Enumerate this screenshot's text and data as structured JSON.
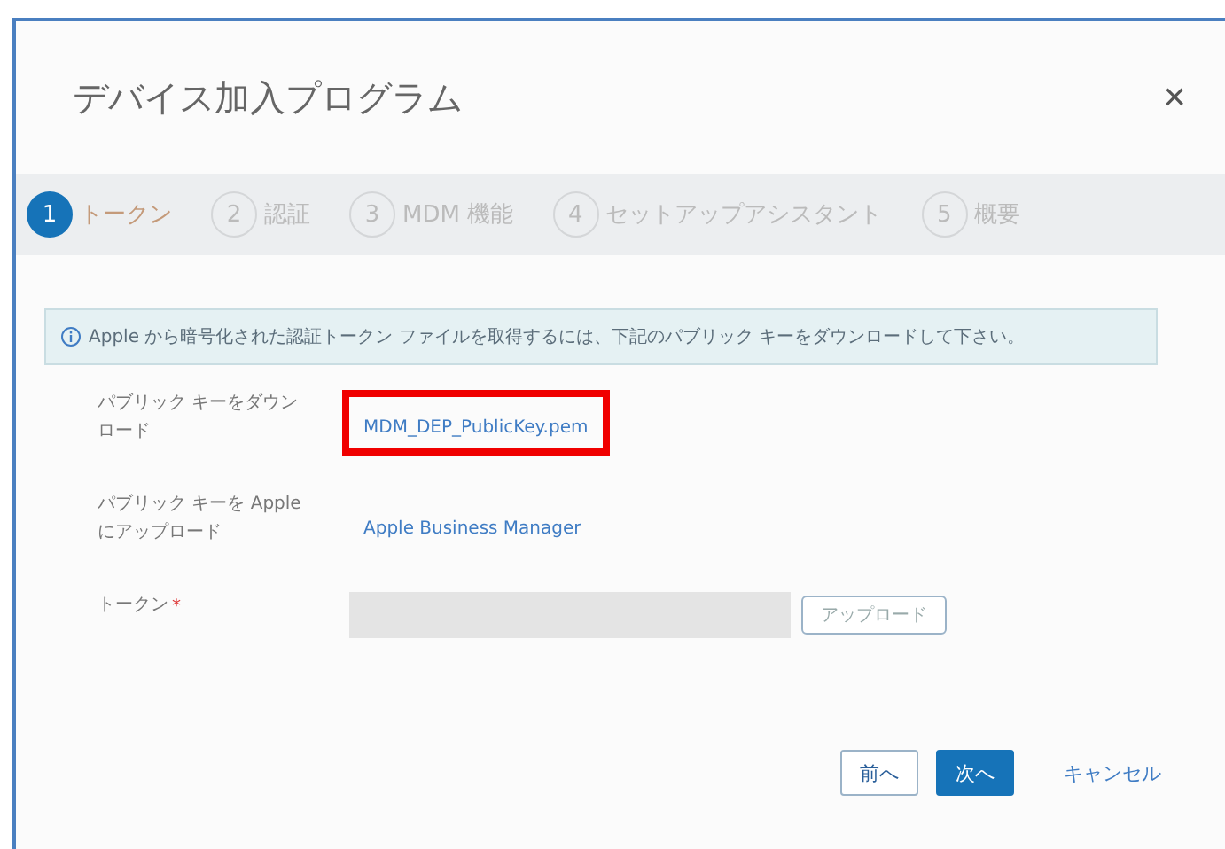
{
  "dialog": {
    "title": "デバイス加入プログラム",
    "close": "×"
  },
  "steps": [
    {
      "number": "1",
      "label": "トークン",
      "selected": true
    },
    {
      "number": "2",
      "label": "認証",
      "selected": false
    },
    {
      "number": "3",
      "label": "MDM 機能",
      "selected": false
    },
    {
      "number": "4",
      "label": "セットアップアシスタント",
      "selected": false
    },
    {
      "number": "5",
      "label": "概要",
      "selected": false
    }
  ],
  "info": "Apple から暗号化された認証トークン ファイルを取得するには、下記のパブリック キーをダウンロードして下さい。",
  "fields": [
    {
      "kind": "link",
      "label": "パブリック キーをダウンロード",
      "value": "MDM_DEP_PublicKey.pem",
      "highlighted": true
    },
    {
      "kind": "link",
      "label": "パブリック キーを Apple にアップロード",
      "value": "Apple Business Manager",
      "highlighted": false
    },
    {
      "kind": "upload",
      "label": "トークン",
      "required_mark": "*",
      "button": "アップロード"
    }
  ],
  "buttons": [
    {
      "label": "前へ",
      "kind": "secondary"
    },
    {
      "label": "次へ",
      "kind": "primary"
    },
    {
      "label": "キャンセル",
      "kind": "link"
    }
  ]
}
